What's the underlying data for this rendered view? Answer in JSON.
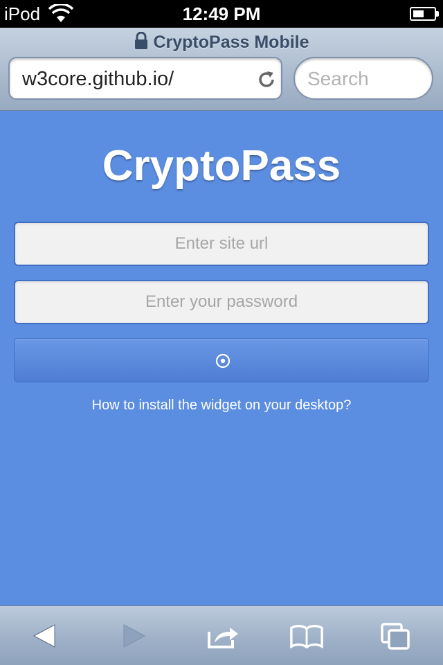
{
  "status_bar": {
    "carrier": "iPod",
    "time": "12:49 PM",
    "battery_level": 0.55
  },
  "browser": {
    "page_title": "CryptoPass Mobile",
    "url": "w3core.github.io/",
    "search_placeholder": "Search"
  },
  "app": {
    "title": "CryptoPass",
    "site_url_placeholder": "Enter site url",
    "password_placeholder": "Enter your password",
    "help_link": "How to install the widget on your desktop?"
  },
  "toolbar": {
    "back": "back-arrow-icon",
    "forward": "forward-arrow-icon",
    "share": "share-icon",
    "bookmarks": "bookmarks-icon",
    "tabs": "tabs-icon"
  },
  "colors": {
    "background": "#5b8de0",
    "accent": "#3f6ec3",
    "toolbar": "#a9b9cd"
  }
}
